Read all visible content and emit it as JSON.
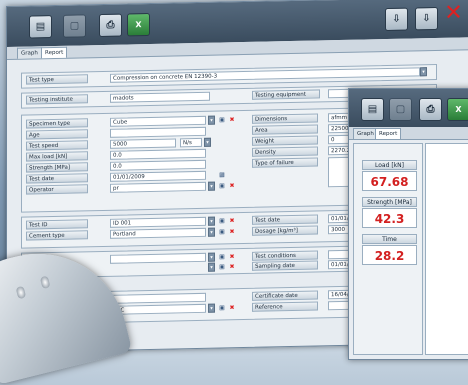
{
  "main": {
    "toolbar": {
      "icons": [
        "open-icon",
        "disabled-icon",
        "printer-icon",
        "excel-icon",
        "export-icon",
        "export-red-icon",
        "close-icon"
      ],
      "excel_glyph": "X"
    },
    "tabs": [
      "Graph",
      "Report"
    ],
    "test_type": {
      "label": "Test type",
      "value": "Compression on concrete EN 12390-3"
    },
    "testing_institute": {
      "label": "Testing institute",
      "value": "madots"
    },
    "testing_equipment": {
      "label": "Testing equipment",
      "value": ""
    },
    "left_fields": [
      {
        "label": "Specimen type",
        "value": "Cube",
        "dropdown": true,
        "save": true,
        "delete": true
      },
      {
        "label": "Age",
        "value": "",
        "dropdown": false
      },
      {
        "label": "Test speed",
        "value": "5000",
        "unit": "N/s",
        "dropdown": true
      },
      {
        "label": "Max load [kN]",
        "value": "0.0",
        "dropdown": false
      },
      {
        "label": "Strength [MPa]",
        "value": "0.0",
        "dropdown": false
      },
      {
        "label": "Test date",
        "value": "01/01/2009",
        "dropdown": false
      },
      {
        "label": "Operator",
        "value": "pr",
        "dropdown": true,
        "save": true,
        "delete": true
      }
    ],
    "right_fields": [
      {
        "label": "Dimensions",
        "value": "afmm"
      },
      {
        "label": "Area",
        "value": "22500"
      },
      {
        "label": "Weight",
        "value": "0"
      },
      {
        "label": "Density",
        "value": "2270.27"
      },
      {
        "label": "Type of failure",
        "value": ""
      }
    ],
    "section3_left": [
      {
        "label": "Test ID",
        "value": "ID 001"
      },
      {
        "label": "Cement type",
        "value": "Portland"
      }
    ],
    "section3_right": [
      {
        "label": "Test date",
        "value": "01/01/2"
      },
      {
        "label": "Dosage [kg/m³]",
        "value": "3000"
      }
    ],
    "section4_right": [
      {
        "label": "Test conditions",
        "value": ""
      },
      {
        "label": "Sampling date",
        "value": "01/01/2"
      }
    ],
    "section5_left": [
      {
        "label": "",
        "value": ""
      },
      {
        "label": "",
        "value": "ABC"
      }
    ],
    "section5_right": [
      {
        "label": "Certificate date",
        "value": "16/04/2"
      },
      {
        "label": "Reference",
        "value": ""
      }
    ]
  },
  "second": {
    "tabs": [
      "Graph",
      "Report"
    ],
    "metrics": [
      {
        "label": "Load [kN]",
        "value": "67.68"
      },
      {
        "label": "Strength [MPa]",
        "value": "42.3"
      },
      {
        "label": "Time",
        "value": "28.2"
      }
    ]
  },
  "colors": {
    "accent_red": "#d32020",
    "toolbar": "#3a4c5e"
  }
}
